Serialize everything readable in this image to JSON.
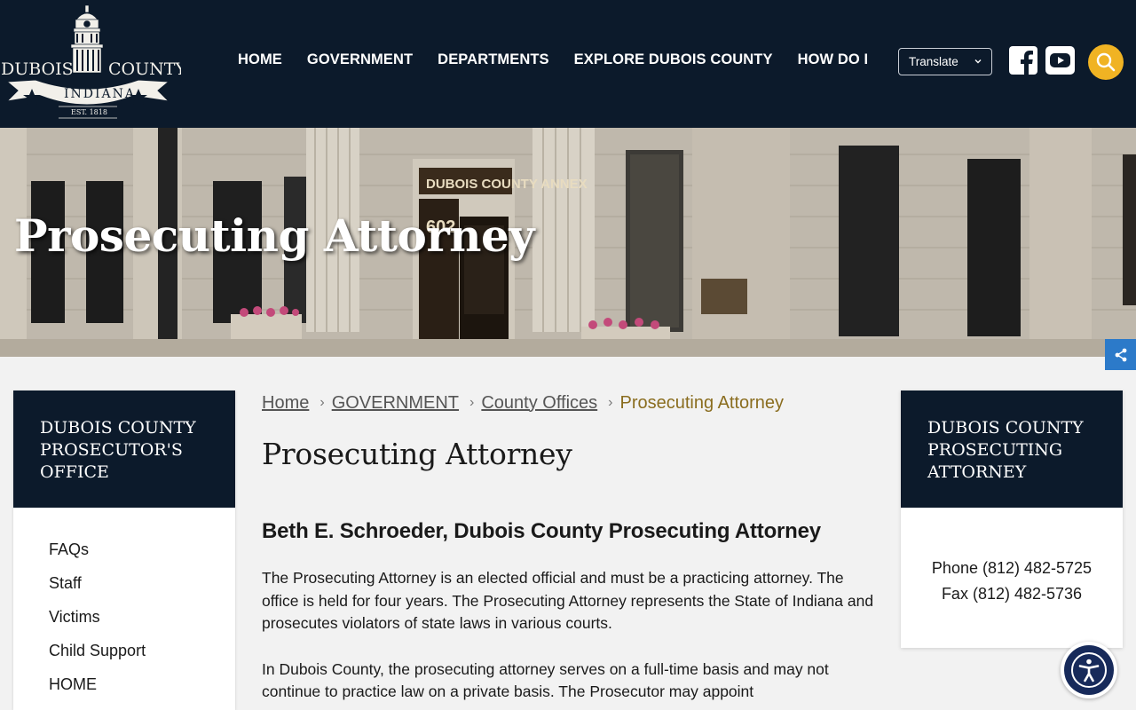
{
  "header": {
    "logo": {
      "name_left": "DUBOIS",
      "name_right": "COUNTY",
      "state": "INDIANA",
      "est": "EST. 1818"
    },
    "nav": [
      "HOME",
      "GOVERNMENT",
      "DEPARTMENTS",
      "EXPLORE DUBOIS COUNTY",
      "HOW DO I"
    ],
    "translate_label": "Translate",
    "icons": [
      "facebook-icon",
      "youtube-icon",
      "search-icon"
    ],
    "accent_color": "#f0b323",
    "bg_color": "#0c1a2b"
  },
  "hero": {
    "title": "Prosecuting Attorney",
    "building_sign": "DUBOIS COUNTY ANNEX",
    "building_number": "602"
  },
  "left_sidebar": {
    "heading": "DUBOIS COUNTY PROSECUTOR'S OFFICE",
    "items": [
      "FAQs",
      "Staff",
      "Victims",
      "Child Support",
      "HOME"
    ]
  },
  "breadcrumb": {
    "items": [
      "Home",
      "GOVERNMENT",
      "County Offices"
    ],
    "current": "Prosecuting Attorney"
  },
  "main": {
    "title": "Prosecuting Attorney",
    "subheading": "Beth E. Schroeder, Dubois County Prosecuting Attorney",
    "para1": "The Prosecuting Attorney is an elected official and must be a practicing attorney. The office is held for four years. The Prosecuting Attorney represents the State of Indiana and prosecutes violators of state laws in various courts.",
    "para2": "In Dubois County, the prosecuting attorney serves on a full-time basis and may not continue to practice law on a private basis. The Prosecutor may appoint"
  },
  "right_card": {
    "heading": "DUBOIS COUNTY PROSECUTING ATTORNEY",
    "phone": "Phone (812) 482-5725",
    "fax": "Fax (812) 482-5736"
  }
}
